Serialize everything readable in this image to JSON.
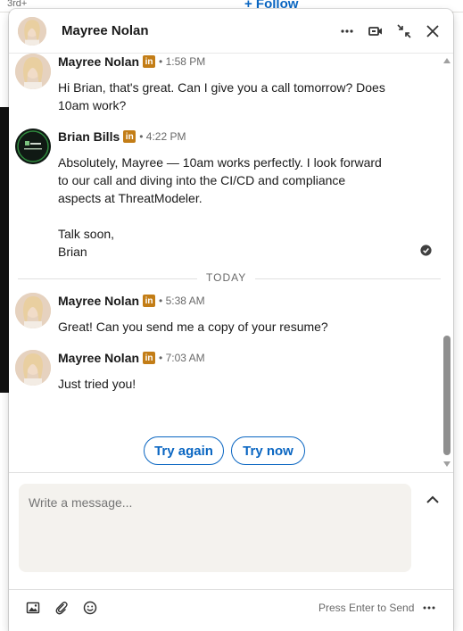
{
  "background": {
    "connection_degree": "3rd+",
    "follow_label": "+ Follow"
  },
  "header": {
    "title": "Mayree Nolan",
    "icons": [
      "more-icon",
      "video-call-icon",
      "minimize-icon",
      "close-icon"
    ]
  },
  "messages": [
    {
      "sender": "Mayree Nolan",
      "badge": "in",
      "time": "• 1:58 PM",
      "lines": [
        "Hi Brian, that's great. Can I give you a call tomorrow? Does",
        "10am work?"
      ]
    },
    {
      "sender": "Brian Bills",
      "badge": "in",
      "time": "• 4:22 PM",
      "lines": [
        "Absolutely, Mayree — 10am works perfectly. I look forward",
        "to our call and diving into the CI/CD and compliance",
        "aspects at ThreatModeler.",
        "",
        "Talk soon,",
        "Brian"
      ]
    },
    {
      "sender": "Mayree Nolan",
      "badge": "in",
      "time": "• 5:38 AM",
      "lines": [
        "Great! Can you send me a copy of your resume?"
      ]
    },
    {
      "sender": "Mayree Nolan",
      "badge": "in",
      "time": "• 7:03 AM",
      "lines": [
        "Just tried you!"
      ]
    }
  ],
  "divider": "TODAY",
  "actions": {
    "try_again": "Try again",
    "try_now": "Try now"
  },
  "compose": {
    "placeholder": "Write a message..."
  },
  "footer": {
    "send_hint": "Press Enter to Send"
  },
  "colors": {
    "accent": "#0a66c2",
    "premium_badge": "#c37d16"
  }
}
